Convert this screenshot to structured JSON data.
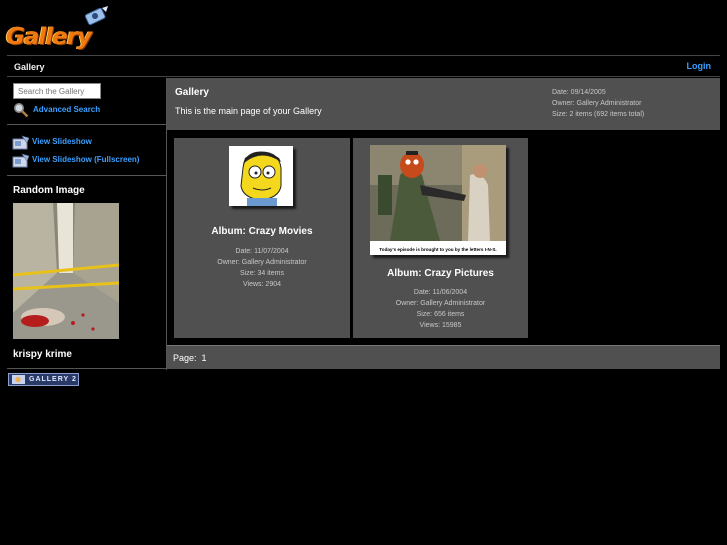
{
  "brand": {
    "logo_text": "Gallery",
    "badge_text": "GALLERY 2"
  },
  "topbar": {
    "breadcrumb": "Gallery",
    "login_label": "Login"
  },
  "sidebar": {
    "search_placeholder": "Search the Gallery",
    "advanced_search_label": "Advanced Search",
    "slideshow_label": "View Slideshow",
    "slideshow_full_label": "View Slideshow (Fullscreen)",
    "random_title": "Random Image",
    "random_caption": "krispy krime"
  },
  "header": {
    "title": "Gallery",
    "description": "This is the main page of your Gallery",
    "date": "Date: 09/14/2005",
    "owner": "Owner: Gallery Administrator",
    "size": "Size: 2 items (692 items total)"
  },
  "albums": [
    {
      "title": "Album: Crazy Movies",
      "date": "Date: 11/07/2004",
      "owner": "Owner: Gallery Administrator",
      "size": "Size: 34 items",
      "views": "Views: 2904"
    },
    {
      "title": "Album: Crazy Pictures",
      "date": "Date: 11/06/2004",
      "owner": "Owner: Gallery Administrator",
      "size": "Size: 656 items",
      "views": "Views: 15985",
      "thumb_caption": "Today's episode is brought to you by the letters I-N-S."
    }
  ],
  "pager": {
    "label": "Page:",
    "current": "1"
  },
  "colors": {
    "accent_link": "#3aa0ff",
    "panel": "#505050",
    "background": "#000000",
    "logo": "#f07a10"
  }
}
